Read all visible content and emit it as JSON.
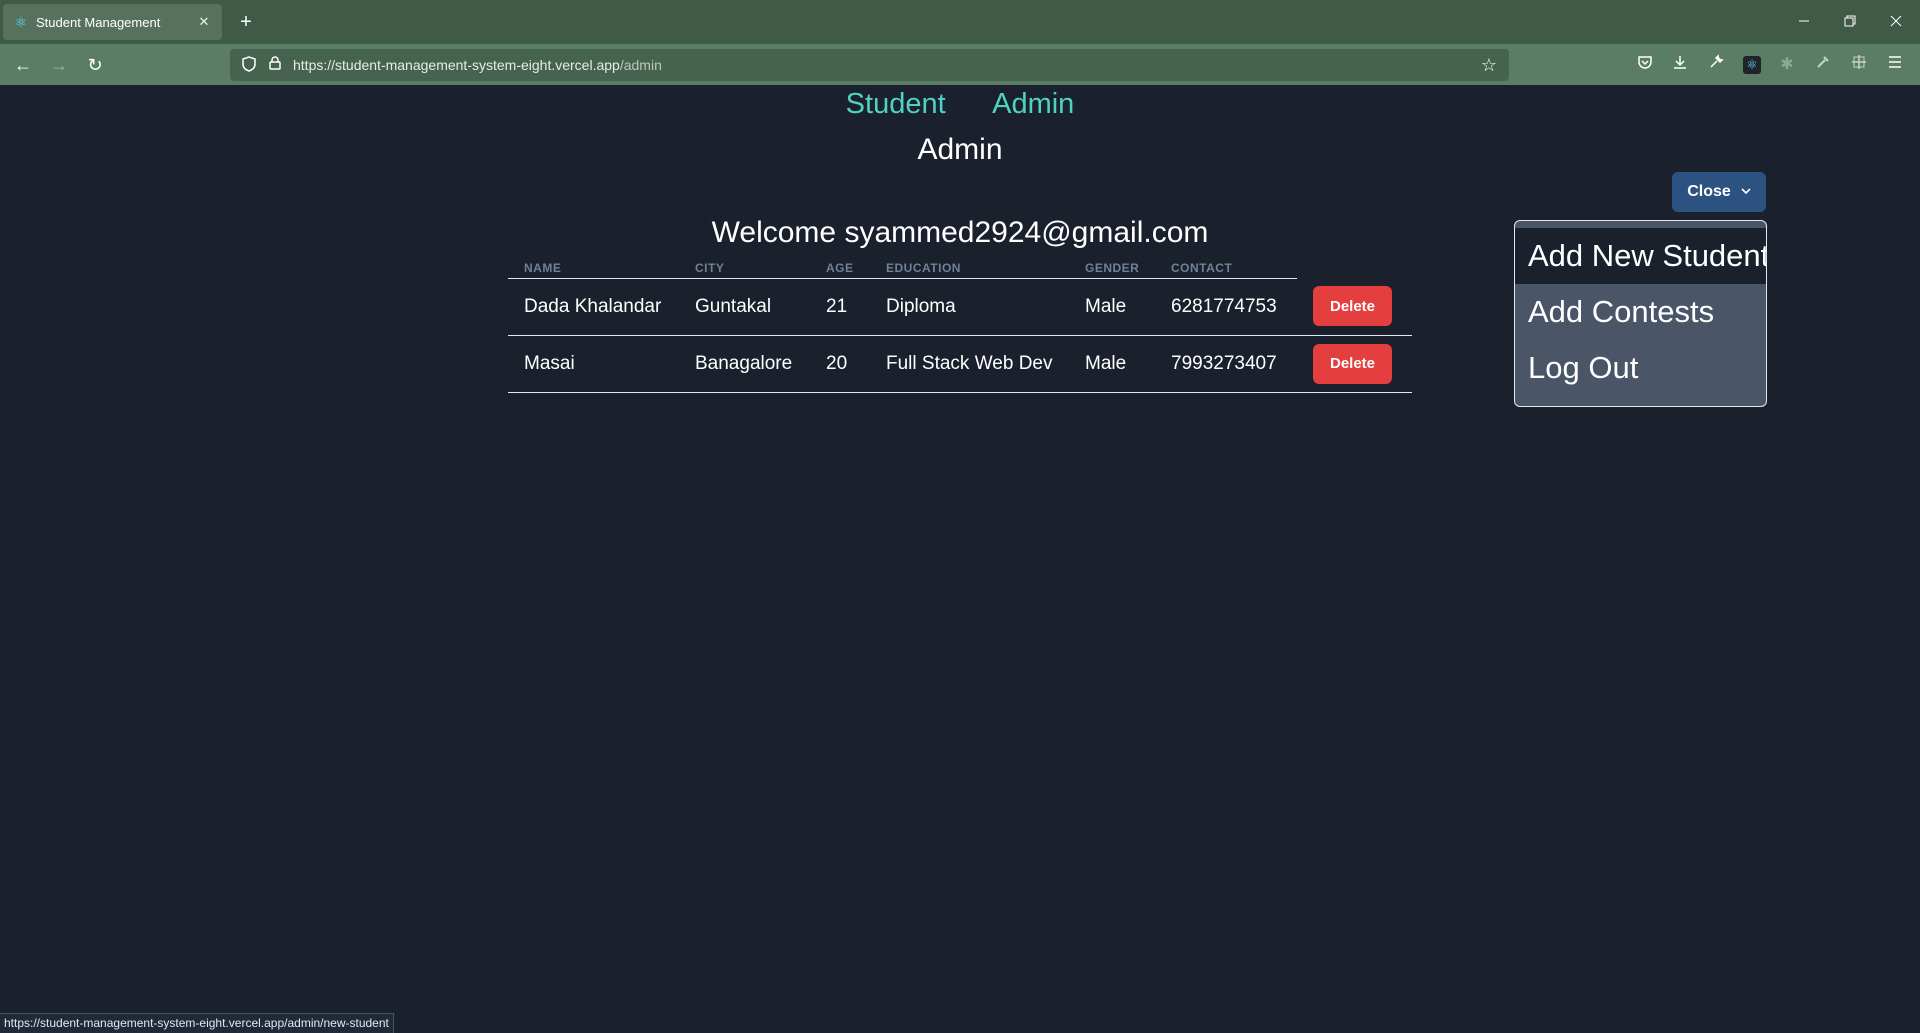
{
  "browser": {
    "tab_title": "Student Management",
    "tab_close": "✕",
    "new_tab": "+",
    "url_base": "https://student-management-system-eight.vercel.app",
    "url_path": "/admin",
    "status_url": "https://student-management-system-eight.vercel.app/admin/new-student"
  },
  "nav": {
    "links": [
      "Student",
      "Admin"
    ],
    "heading": "Admin"
  },
  "welcome": "Welcome syammed2924@gmail.com",
  "table": {
    "headers": [
      "NAME",
      "CITY",
      "AGE",
      "EDUCATION",
      "GENDER",
      "CONTACT"
    ],
    "rows": [
      [
        "Dada Khalandar",
        "Guntakal",
        "21",
        "Diploma",
        "Male",
        "6281774753"
      ],
      [
        "Masai",
        "Banagalore",
        "20",
        "Full Stack Web Dev",
        "Male",
        "7993273407"
      ]
    ],
    "delete_label": "Delete"
  },
  "menu": {
    "button_label": "Close",
    "items": [
      "Add New Student",
      "Add Contests",
      "Log Out"
    ]
  },
  "colors": {
    "background": "#1a202c",
    "link": "#4fd1c5",
    "delete": "#e53e3e",
    "menu_button": "#2c5282",
    "browser_chrome": "#5b7d66"
  }
}
